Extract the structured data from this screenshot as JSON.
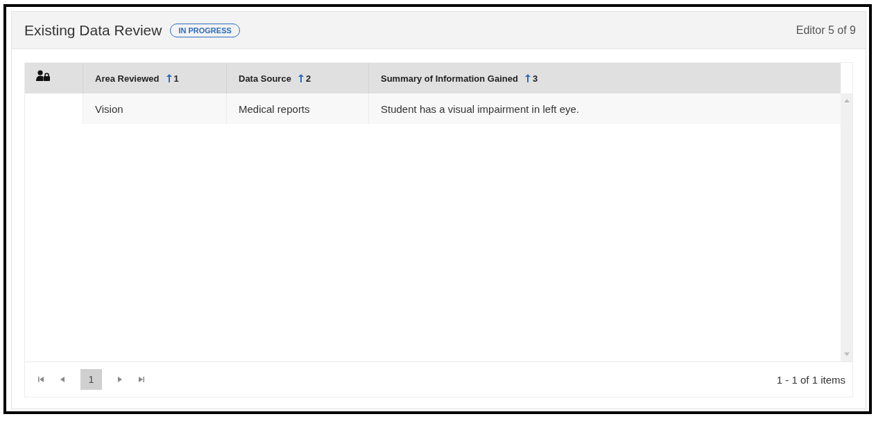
{
  "panel": {
    "title": "Existing Data Review",
    "status_badge": "IN PROGRESS",
    "editor_position": "Editor 5 of 9"
  },
  "table": {
    "columns": [
      {
        "kind": "icon"
      },
      {
        "kind": "text",
        "label": "Area Reviewed",
        "sort_ascending": true,
        "sort_order": "1"
      },
      {
        "kind": "text",
        "label": "Data Source",
        "sort_ascending": true,
        "sort_order": "2"
      },
      {
        "kind": "text",
        "label": "Summary of Information Gained",
        "sort_ascending": true,
        "sort_order": "3"
      }
    ],
    "rows": [
      {
        "cells": [
          "",
          "Vision",
          "Medical reports",
          "Student has a visual impairment in left eye."
        ]
      }
    ]
  },
  "pager": {
    "pages": [
      {
        "label": "1",
        "selected": true
      }
    ],
    "summary": "1 - 1 of 1 items"
  }
}
